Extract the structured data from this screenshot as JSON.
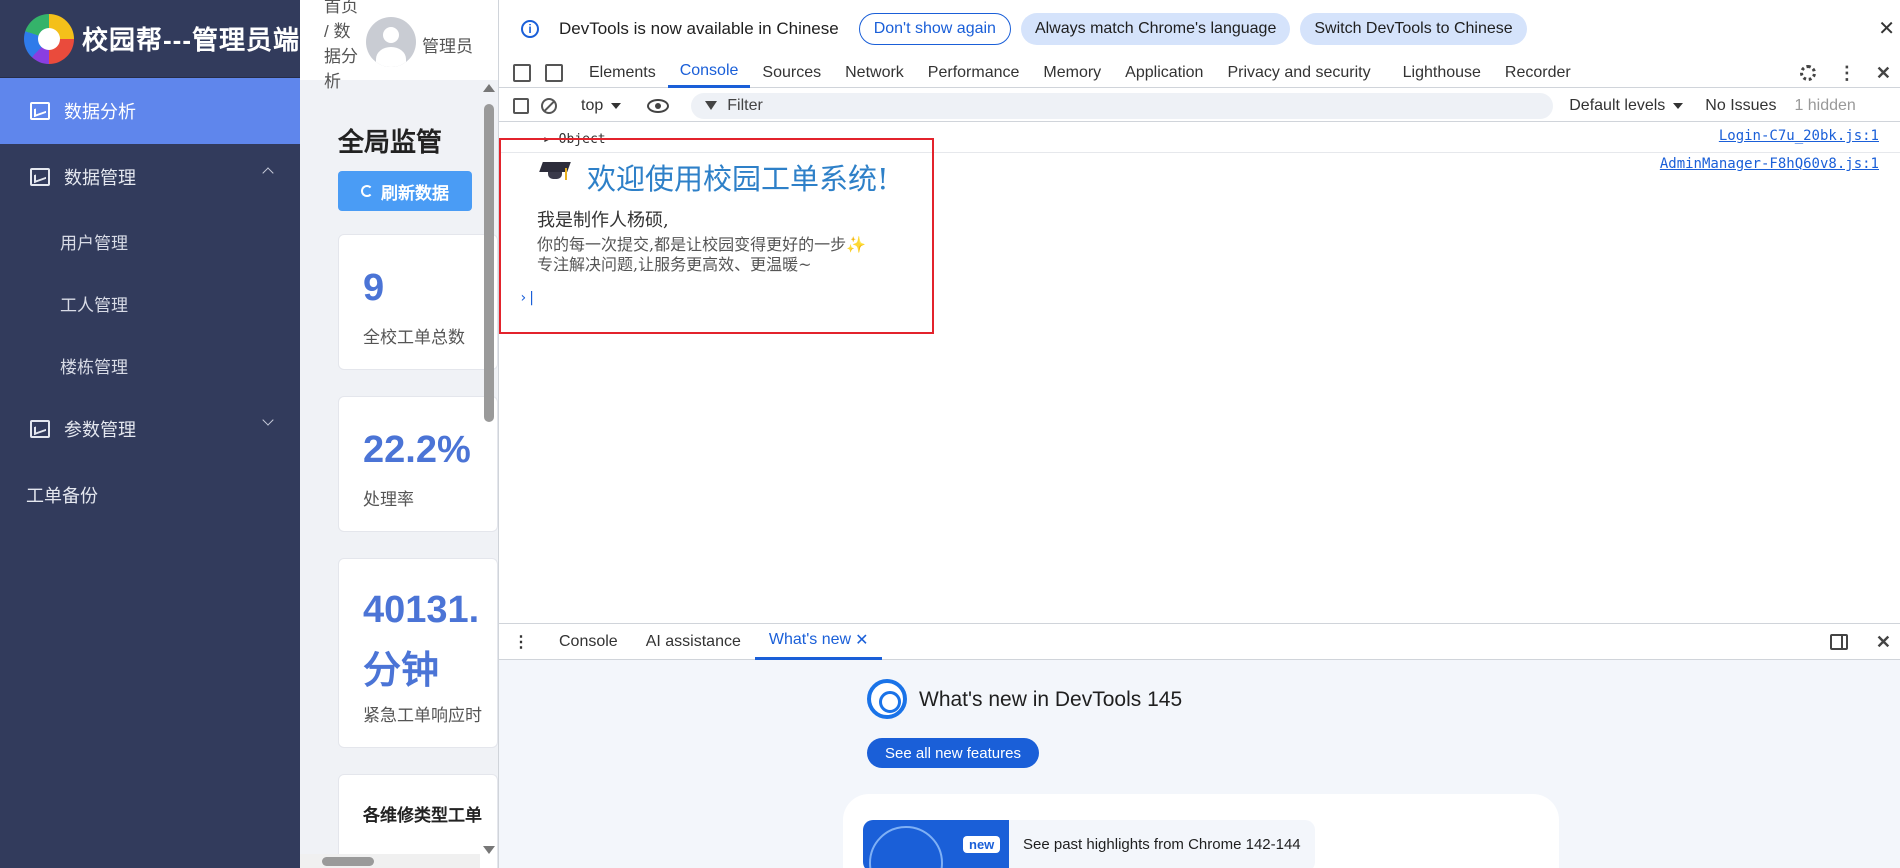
{
  "app": {
    "brand_title": "校园帮---管理员端",
    "menu": [
      {
        "label": "数据分析"
      },
      {
        "label": "数据管理"
      },
      {
        "label": "参数管理"
      }
    ],
    "submenu": [
      {
        "label": "用户管理"
      },
      {
        "label": "工人管理"
      },
      {
        "label": "楼栋管理"
      }
    ],
    "plain_item": "工单备份"
  },
  "content": {
    "breadcrumb": "首页 / 数据分析",
    "admin_name": "管理员",
    "page_title": "全局监管",
    "refresh_label": "刷新数据",
    "cards": [
      {
        "value": "9",
        "label": "全校工单总数"
      },
      {
        "value": "22.2%",
        "label": "处理率"
      },
      {
        "value": "40131.",
        "value2": "分钟",
        "label": "紧急工单响应时"
      },
      {
        "label": "各维修类型工单"
      }
    ]
  },
  "devtools": {
    "info_text": "DevTools is now available in Chinese",
    "btn_dont_show": "Don't show again",
    "btn_match": "Always match Chrome's language",
    "btn_switch": "Switch DevTools to Chinese",
    "tabs": [
      "Elements",
      "Console",
      "Sources",
      "Network",
      "Performance",
      "Memory",
      "Application",
      "Privacy and security",
      "Lighthouse",
      "Recorder"
    ],
    "context": "top",
    "filter_placeholder": "Filter",
    "levels": "Default levels",
    "issues": "No Issues",
    "hidden": "1 hidden",
    "console": {
      "object_label": "Object",
      "source1": "Login-C7u_20bk.js:1",
      "source2": "AdminManager-F8hQ60v8.js:1",
      "welcome": "欢迎使用校园工单系统!",
      "author": "我是制作人杨硕,",
      "line2": "你的每一次提交,都是让校园变得更好的一步",
      "sparkle": "✨",
      "line3": "专注解决问题,让服务更高效、更温暖~"
    },
    "drawer": {
      "tabs": [
        "Console",
        "AI assistance",
        "What's new"
      ],
      "title": "What's new in DevTools 145",
      "see_all": "See all new features",
      "badge": "new",
      "past": "See past highlights from Chrome 142-144"
    }
  }
}
